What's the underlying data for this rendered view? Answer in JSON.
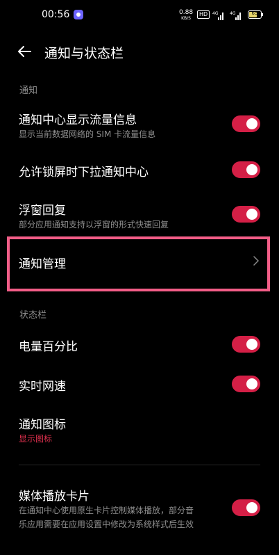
{
  "status_bar": {
    "time": "00:56",
    "net_speed_value": "0.88",
    "net_speed_unit": "KB/S",
    "hd_badge": "HD",
    "signal1_label": "4G",
    "signal2_label": "4G",
    "battery": "65",
    "battery_color": "#e8d66d"
  },
  "header": {
    "title": "通知与状态栏",
    "back_icon": "arrow-left-icon"
  },
  "sections": {
    "notification": "通知",
    "statusbar": "状态栏"
  },
  "items": {
    "traffic": {
      "title": "通知中心显示流量信息",
      "subtitle": "显示当前数据网络的 SIM 卡流量信息",
      "enabled": true
    },
    "lockscreen": {
      "title": "允许锁屏时下拉通知中心",
      "enabled": true
    },
    "floating": {
      "title": "浮窗回复",
      "subtitle": "部分应用通知支持以浮窗的形式快速回复",
      "enabled": true
    },
    "manage": {
      "title": "通知管理",
      "icon": "chevron-right-icon"
    },
    "battery_pct": {
      "title": "电量百分比",
      "enabled": true
    },
    "netspeed": {
      "title": "实时网速",
      "enabled": true
    },
    "notif_icon": {
      "title": "通知图标",
      "value": "显示图标"
    },
    "media": {
      "title": "媒体播放卡片",
      "subtitle_line1": "在通知中心使用原生卡片控制媒体播放，部分音",
      "subtitle_line2": "乐应用需要在应用设置中修改为系统样式后生效",
      "enabled": true
    }
  },
  "colors": {
    "accent": "#d41f46",
    "highlight_box": "#f25d87",
    "value_red": "#e0304e",
    "background": "#000000"
  }
}
